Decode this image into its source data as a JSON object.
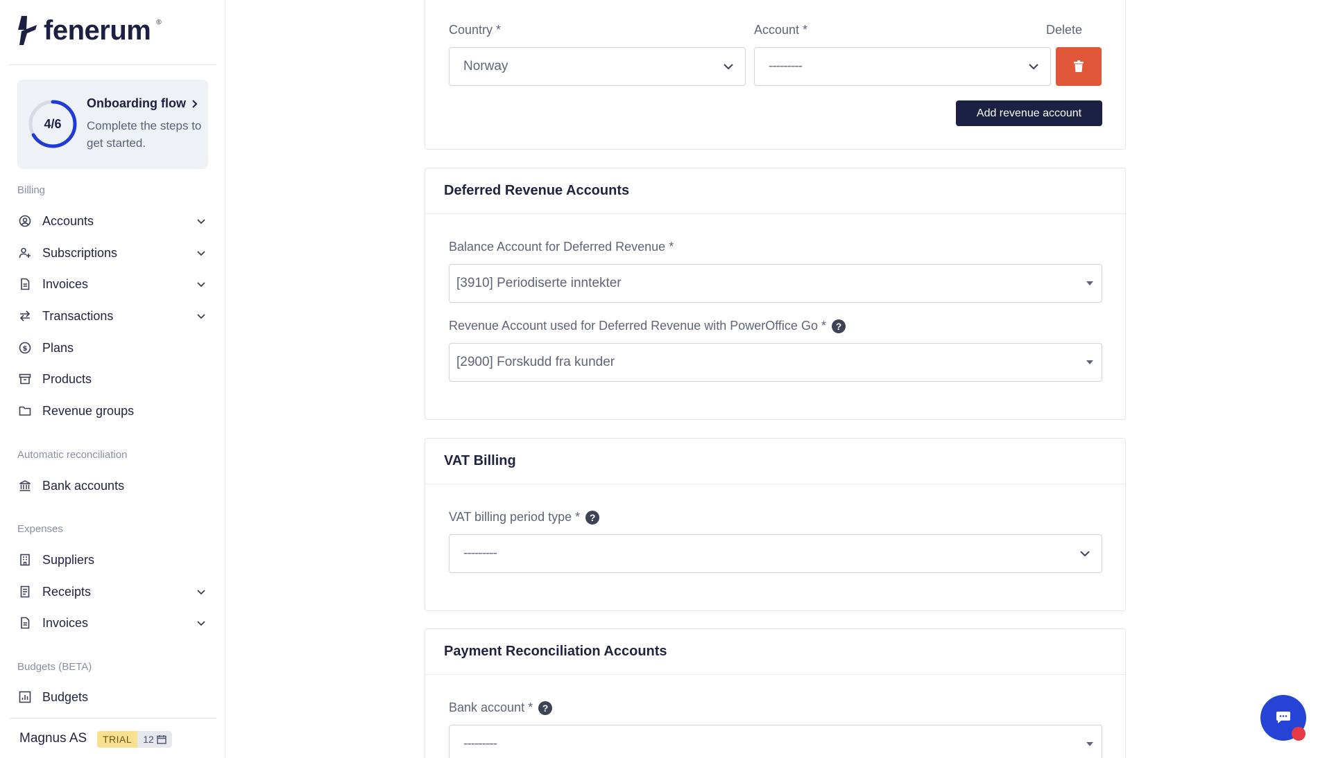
{
  "brand": {
    "name": "fenerum",
    "reg": "®"
  },
  "onboarding": {
    "count": "4/6",
    "title": "Onboarding flow",
    "subtitle": "Complete the steps to get started.",
    "progress": 0.6667
  },
  "sidebar": {
    "sections": {
      "billing": "Billing",
      "reconciliation": "Automatic reconciliation",
      "expenses": "Expenses",
      "budgets": "Budgets (BETA)"
    },
    "items": {
      "accounts": "Accounts",
      "subscriptions": "Subscriptions",
      "invoices": "Invoices",
      "transactions": "Transactions",
      "plans": "Plans",
      "products": "Products",
      "revenue_groups": "Revenue groups",
      "bank_accounts": "Bank accounts",
      "suppliers": "Suppliers",
      "receipts": "Receipts",
      "expense_invoices": "Invoices",
      "budgets": "Budgets"
    },
    "footer": {
      "org": "Magnus AS",
      "badge": "TRIAL",
      "days": "12"
    }
  },
  "revenue_accounts": {
    "country_label": "Country *",
    "account_label": "Account *",
    "delete_label": "Delete",
    "country_value": "Norway",
    "account_value": "---------",
    "add_button": "Add revenue account"
  },
  "deferred": {
    "title": "Deferred Revenue Accounts",
    "balance_label": "Balance Account for Deferred Revenue *",
    "balance_value": "[3910] Periodiserte inntekter",
    "revenue_label": "Revenue Account used for Deferred Revenue with PowerOffice Go *",
    "revenue_value": "[2900] Forskudd fra kunder"
  },
  "vat": {
    "title": "VAT Billing",
    "period_label": "VAT billing period type *",
    "period_value": "---------"
  },
  "payment": {
    "title": "Payment Reconciliation Accounts",
    "bank_label": "Bank account *",
    "bank_value": "---------"
  },
  "colors": {
    "brand_dark": "#1c2042",
    "delete_red": "#e0573a",
    "chat_blue": "#2544d6",
    "trial_yellow": "#f8e08e",
    "progress_blue": "#1f3ad6"
  }
}
